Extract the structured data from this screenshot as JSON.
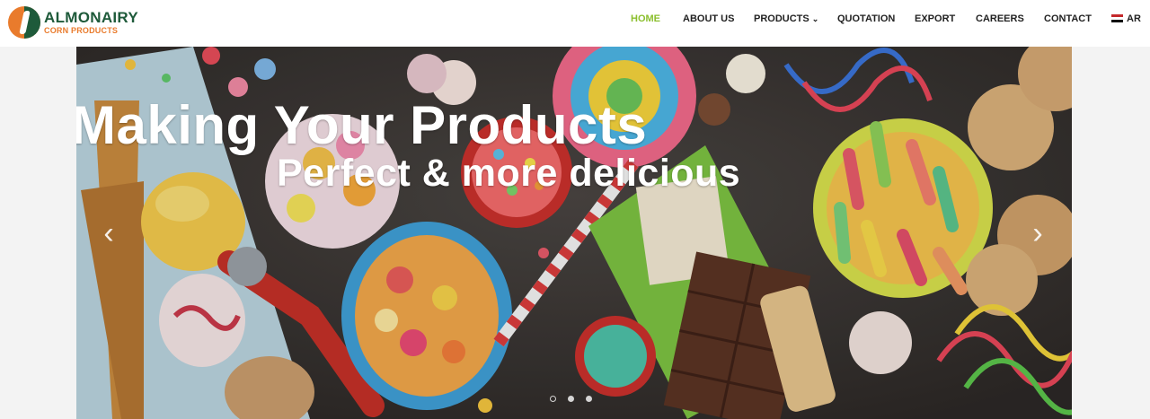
{
  "brand": {
    "name": "ALMONAIRY",
    "sub": "CORN PRODUCTS"
  },
  "nav": [
    {
      "label": "HOME",
      "active": true
    },
    {
      "label": "ABOUT US"
    },
    {
      "label": "PRODUCTS",
      "dropdown": true
    },
    {
      "label": "QUOTATION"
    },
    {
      "label": "EXPORT"
    },
    {
      "label": "CAREERS"
    },
    {
      "label": "CONTACT"
    },
    {
      "label": "AR",
      "flag": "egypt-flag-icon"
    }
  ],
  "hero": {
    "title_line1": "Making Your Products",
    "title_line2": "Perfect & more delicious",
    "prev_icon": "chevron-left-icon",
    "next_icon": "chevron-right-icon",
    "slides": 3,
    "active_slide": 1
  },
  "colors": {
    "accent": "#8bbf2e",
    "brand_green": "#1e5a3a",
    "brand_orange": "#e97b2c"
  }
}
